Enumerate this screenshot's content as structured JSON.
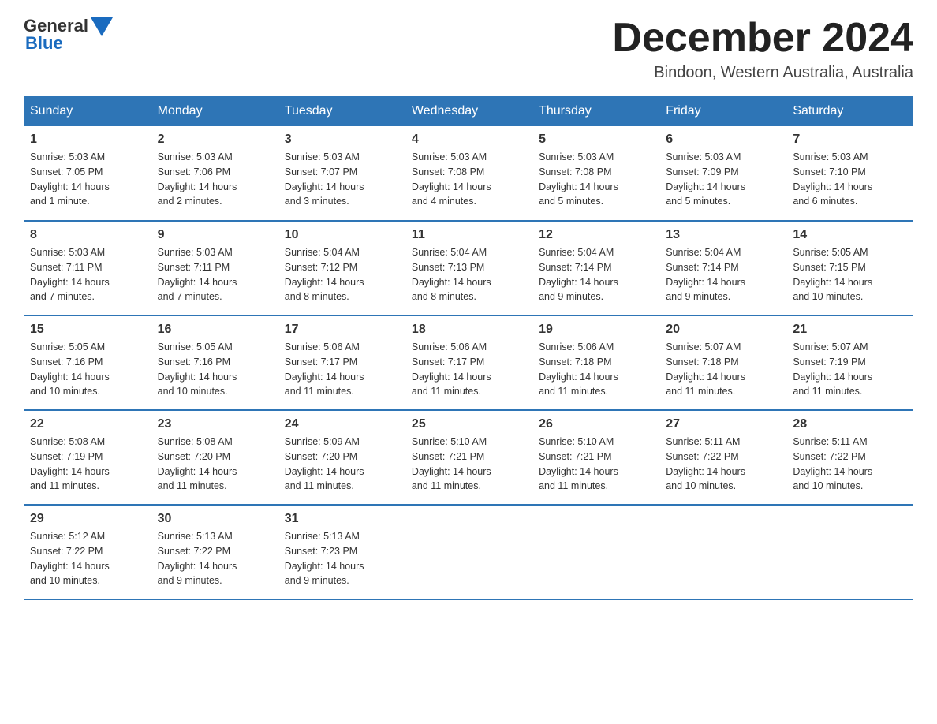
{
  "header": {
    "logo": {
      "text_general": "General",
      "text_blue": "Blue",
      "arrow_color": "#1a6bbf"
    },
    "title": "December 2024",
    "subtitle": "Bindoon, Western Australia, Australia"
  },
  "weekdays": [
    "Sunday",
    "Monday",
    "Tuesday",
    "Wednesday",
    "Thursday",
    "Friday",
    "Saturday"
  ],
  "weeks": [
    [
      {
        "day": "1",
        "sunrise": "5:03 AM",
        "sunset": "7:05 PM",
        "daylight": "14 hours and 1 minute."
      },
      {
        "day": "2",
        "sunrise": "5:03 AM",
        "sunset": "7:06 PM",
        "daylight": "14 hours and 2 minutes."
      },
      {
        "day": "3",
        "sunrise": "5:03 AM",
        "sunset": "7:07 PM",
        "daylight": "14 hours and 3 minutes."
      },
      {
        "day": "4",
        "sunrise": "5:03 AM",
        "sunset": "7:08 PM",
        "daylight": "14 hours and 4 minutes."
      },
      {
        "day": "5",
        "sunrise": "5:03 AM",
        "sunset": "7:08 PM",
        "daylight": "14 hours and 5 minutes."
      },
      {
        "day": "6",
        "sunrise": "5:03 AM",
        "sunset": "7:09 PM",
        "daylight": "14 hours and 5 minutes."
      },
      {
        "day": "7",
        "sunrise": "5:03 AM",
        "sunset": "7:10 PM",
        "daylight": "14 hours and 6 minutes."
      }
    ],
    [
      {
        "day": "8",
        "sunrise": "5:03 AM",
        "sunset": "7:11 PM",
        "daylight": "14 hours and 7 minutes."
      },
      {
        "day": "9",
        "sunrise": "5:03 AM",
        "sunset": "7:11 PM",
        "daylight": "14 hours and 7 minutes."
      },
      {
        "day": "10",
        "sunrise": "5:04 AM",
        "sunset": "7:12 PM",
        "daylight": "14 hours and 8 minutes."
      },
      {
        "day": "11",
        "sunrise": "5:04 AM",
        "sunset": "7:13 PM",
        "daylight": "14 hours and 8 minutes."
      },
      {
        "day": "12",
        "sunrise": "5:04 AM",
        "sunset": "7:14 PM",
        "daylight": "14 hours and 9 minutes."
      },
      {
        "day": "13",
        "sunrise": "5:04 AM",
        "sunset": "7:14 PM",
        "daylight": "14 hours and 9 minutes."
      },
      {
        "day": "14",
        "sunrise": "5:05 AM",
        "sunset": "7:15 PM",
        "daylight": "14 hours and 10 minutes."
      }
    ],
    [
      {
        "day": "15",
        "sunrise": "5:05 AM",
        "sunset": "7:16 PM",
        "daylight": "14 hours and 10 minutes."
      },
      {
        "day": "16",
        "sunrise": "5:05 AM",
        "sunset": "7:16 PM",
        "daylight": "14 hours and 10 minutes."
      },
      {
        "day": "17",
        "sunrise": "5:06 AM",
        "sunset": "7:17 PM",
        "daylight": "14 hours and 11 minutes."
      },
      {
        "day": "18",
        "sunrise": "5:06 AM",
        "sunset": "7:17 PM",
        "daylight": "14 hours and 11 minutes."
      },
      {
        "day": "19",
        "sunrise": "5:06 AM",
        "sunset": "7:18 PM",
        "daylight": "14 hours and 11 minutes."
      },
      {
        "day": "20",
        "sunrise": "5:07 AM",
        "sunset": "7:18 PM",
        "daylight": "14 hours and 11 minutes."
      },
      {
        "day": "21",
        "sunrise": "5:07 AM",
        "sunset": "7:19 PM",
        "daylight": "14 hours and 11 minutes."
      }
    ],
    [
      {
        "day": "22",
        "sunrise": "5:08 AM",
        "sunset": "7:19 PM",
        "daylight": "14 hours and 11 minutes."
      },
      {
        "day": "23",
        "sunrise": "5:08 AM",
        "sunset": "7:20 PM",
        "daylight": "14 hours and 11 minutes."
      },
      {
        "day": "24",
        "sunrise": "5:09 AM",
        "sunset": "7:20 PM",
        "daylight": "14 hours and 11 minutes."
      },
      {
        "day": "25",
        "sunrise": "5:10 AM",
        "sunset": "7:21 PM",
        "daylight": "14 hours and 11 minutes."
      },
      {
        "day": "26",
        "sunrise": "5:10 AM",
        "sunset": "7:21 PM",
        "daylight": "14 hours and 11 minutes."
      },
      {
        "day": "27",
        "sunrise": "5:11 AM",
        "sunset": "7:22 PM",
        "daylight": "14 hours and 10 minutes."
      },
      {
        "day": "28",
        "sunrise": "5:11 AM",
        "sunset": "7:22 PM",
        "daylight": "14 hours and 10 minutes."
      }
    ],
    [
      {
        "day": "29",
        "sunrise": "5:12 AM",
        "sunset": "7:22 PM",
        "daylight": "14 hours and 10 minutes."
      },
      {
        "day": "30",
        "sunrise": "5:13 AM",
        "sunset": "7:22 PM",
        "daylight": "14 hours and 9 minutes."
      },
      {
        "day": "31",
        "sunrise": "5:13 AM",
        "sunset": "7:23 PM",
        "daylight": "14 hours and 9 minutes."
      },
      null,
      null,
      null,
      null
    ]
  ],
  "labels": {
    "sunrise": "Sunrise:",
    "sunset": "Sunset:",
    "daylight": "Daylight:"
  }
}
